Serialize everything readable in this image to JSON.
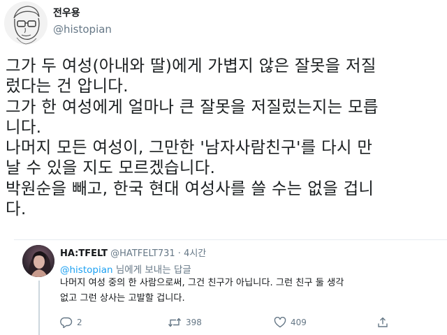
{
  "tweet": {
    "author_name": "전우용",
    "author_handle": "@histopian",
    "avatar_icon": "sketch-portrait-avatar",
    "text_lines": [
      "그가 두 여성(아내와 딸)에게 가볍지 않은 잘못을 저질",
      "렀다는 건 압니다.",
      "그가 한 여성에게 얼마나 큰 잘못을 저질렀는지는 모릅",
      "니다.",
      "나머지 모든 여성이, 그만한 '남자사람친구'를 다시 만",
      "날 수 있을 지도 모르겠습니다.",
      "박원순을 빼고, 한국 현대 여성사를 쓸 수는 없을 겁니",
      "다."
    ]
  },
  "reply": {
    "author_name": "HA:TFELT",
    "author_handle": "@HATFELT731",
    "separator": " · ",
    "time": "4시간",
    "reply_to_mention": "@histopian",
    "reply_to_suffix": " 님에게 보내는 답글",
    "avatar_icon": "profile-photo-avatar",
    "text_lines": [
      "나머지 여성 중의 한 사람으로써, 그건 친구가 아닙니다. 그런 친구 둘 생각",
      "없고 그런 상사는 고발할 겁니다."
    ],
    "actions": {
      "reply_count": "2",
      "retweet_count": "398",
      "like_count": "409"
    }
  },
  "colors": {
    "text": "#14171a",
    "secondary": "#657786",
    "link": "#1da1f2",
    "divider": "#e6ecf0"
  }
}
